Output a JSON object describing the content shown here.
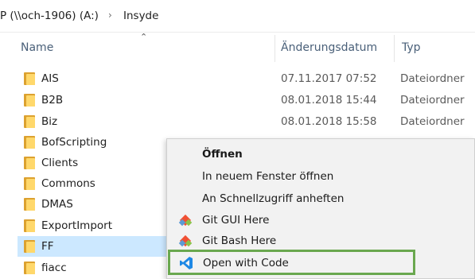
{
  "breadcrumb": {
    "drive": "P (\\\\och-1906) (A:)",
    "separator": "›",
    "folder": "Insyde"
  },
  "columns": {
    "name": "Name",
    "date": "Änderungsdatum",
    "type": "Typ"
  },
  "files": [
    {
      "name": "AIS",
      "date": "07.11.2017 07:52",
      "type": "Dateiordner"
    },
    {
      "name": "B2B",
      "date": "08.01.2018 15:44",
      "type": "Dateiordner"
    },
    {
      "name": "Biz",
      "date": "08.01.2018 15:58",
      "type": "Dateiordner"
    },
    {
      "name": "BofScripting",
      "date": "",
      "type": ""
    },
    {
      "name": "Clients",
      "date": "",
      "type": ""
    },
    {
      "name": "Commons",
      "date": "",
      "type": ""
    },
    {
      "name": "DMAS",
      "date": "",
      "type": ""
    },
    {
      "name": "ExportImport",
      "date": "",
      "type": ""
    },
    {
      "name": "FF",
      "date": "",
      "type": ""
    },
    {
      "name": "fiacc",
      "date": "",
      "type": ""
    }
  ],
  "selected_file": "FF",
  "context_menu": {
    "items": [
      {
        "label": "Öffnen",
        "bold": true,
        "icon": ""
      },
      {
        "label": "In neuem Fenster öffnen",
        "bold": false,
        "icon": ""
      },
      {
        "label": "An Schnellzugriff anheften",
        "bold": false,
        "icon": ""
      },
      {
        "label": "Git GUI Here",
        "bold": false,
        "icon": "git-icon"
      },
      {
        "label": "Git Bash Here",
        "bold": false,
        "icon": "git-icon"
      },
      {
        "label": "Open with Code",
        "bold": false,
        "icon": "vscode-icon",
        "highlighted": true
      }
    ]
  },
  "colors": {
    "selection": "#cce8ff",
    "highlight_border": "#6aa84f",
    "folder": "#ffd86b",
    "vscode_blue": "#1e88e5"
  }
}
